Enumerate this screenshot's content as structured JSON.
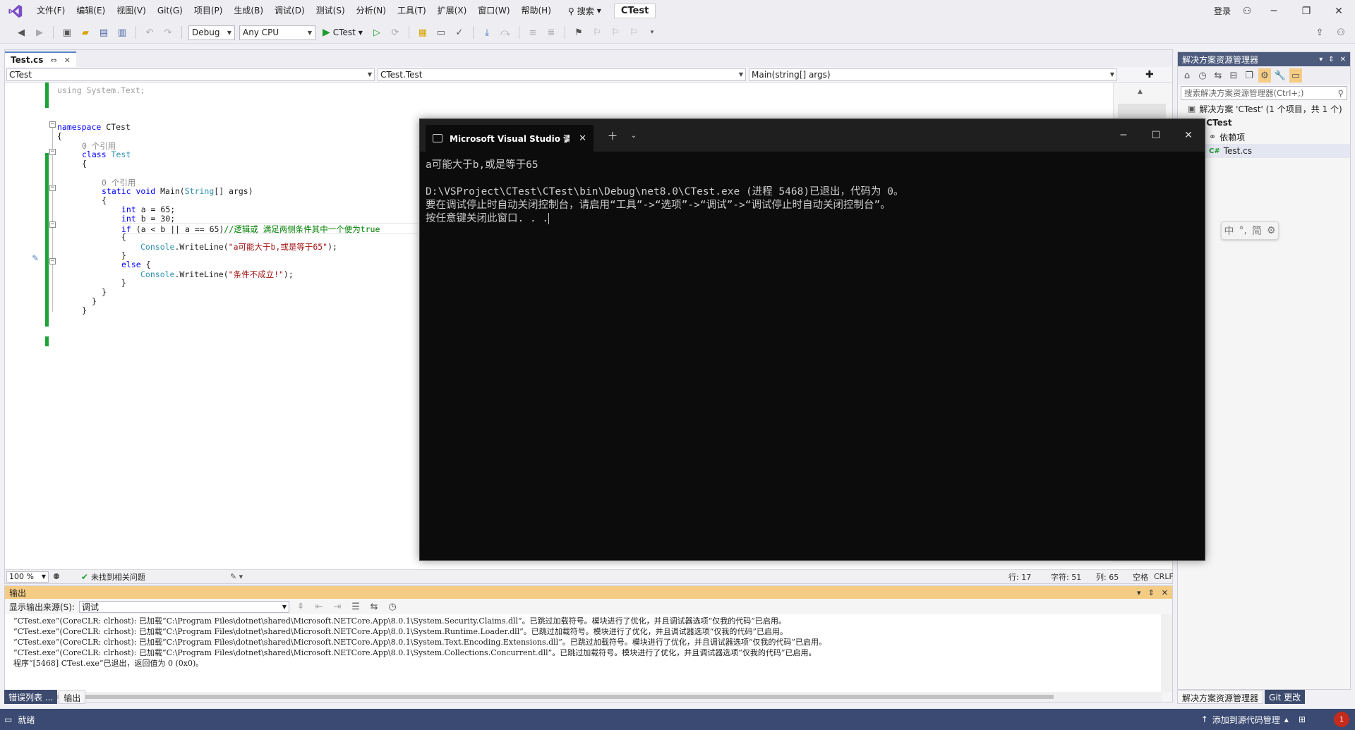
{
  "menubar": {
    "items": [
      "文件(F)",
      "编辑(E)",
      "视图(V)",
      "Git(G)",
      "项目(P)",
      "生成(B)",
      "调试(D)",
      "测试(S)",
      "分析(N)",
      "工具(T)",
      "扩展(X)",
      "窗口(W)",
      "帮助(H)"
    ],
    "search_label": "搜索",
    "solution_name": "CTest",
    "login_label": "登录"
  },
  "toolbar": {
    "config": "Debug",
    "platform": "Any CPU",
    "run_label": "CTest"
  },
  "editor": {
    "tab_label": "Test.cs",
    "nav": {
      "project": "CTest",
      "type": "CTest.Test",
      "member": "Main(string[] args)"
    },
    "lines": {
      "l1": "using System.Text;",
      "ns_kw": "namespace",
      "ns_name": " CTest",
      "brace_open": "{",
      "ref0": "0 个引用",
      "class_kw": "class",
      "class_name": " Test",
      "ref1": "0 个引用",
      "main_static": "static",
      "main_void": " void",
      "main_name": " Main(",
      "main_string": "String",
      "main_args": "[] args)",
      "int_a_kw": "int",
      "int_a": " a = 65;",
      "int_b_kw": "int",
      "int_b": " b = 30;",
      "if_kw": "if",
      "if_cond": " (a < b || a == 65)",
      "if_comment": "//逻辑或 满足两侧条件其中一个便为true",
      "console1_obj": "Console",
      "console1_method": ".WriteLine(",
      "console1_str": "\"a可能大于b,或是等于65\"",
      "console1_end": ");",
      "else_kw": "else",
      "else_brace": " {",
      "console2_obj": "Console",
      "console2_method": ".WriteLine(",
      "console2_str": "\"条件不成立!\"",
      "console2_end": ");",
      "brace_close": "}"
    },
    "status": {
      "zoom": "100 %",
      "issues": "未找到相关问题",
      "line": "行: 17",
      "char": "字符: 51",
      "col": "列: 65",
      "whitespace": "空格",
      "eol": "CRLF"
    }
  },
  "console": {
    "tab_title": "Microsoft Visual Studio 调试控制台",
    "lines": [
      "a可能大于b,或是等于65",
      "",
      "D:\\VSProject\\CTest\\CTest\\bin\\Debug\\net8.0\\CTest.exe (进程 5468)已退出，代码为 0。",
      "要在调试停止时自动关闭控制台，请启用“工具”->“选项”->“调试”->“调试停止时自动关闭控制台”。",
      "按任意键关闭此窗口. . ."
    ]
  },
  "output": {
    "title": "输出",
    "source_label": "显示输出来源(S):",
    "source_value": "调试",
    "lines": [
      "“CTest.exe”(CoreCLR: clrhost): 已加载“C:\\Program Files\\dotnet\\shared\\Microsoft.NETCore.App\\8.0.1\\System.Security.Claims.dll”。已跳过加载符号。模块进行了优化，并且调试器选项“仅我的代码”已启用。",
      "“CTest.exe”(CoreCLR: clrhost): 已加载“C:\\Program Files\\dotnet\\shared\\Microsoft.NETCore.App\\8.0.1\\System.Runtime.Loader.dll”。已跳过加载符号。模块进行了优化，并且调试器选项“仅我的代码”已启用。",
      "“CTest.exe”(CoreCLR: clrhost): 已加载“C:\\Program Files\\dotnet\\shared\\Microsoft.NETCore.App\\8.0.1\\System.Text.Encoding.Extensions.dll”。已跳过加载符号。模块进行了优化，并且调试器选项“仅我的代码”已启用。",
      "“CTest.exe”(CoreCLR: clrhost): 已加载“C:\\Program Files\\dotnet\\shared\\Microsoft.NETCore.App\\8.0.1\\System.Collections.Concurrent.dll”。已跳过加载符号。模块进行了优化，并且调试器选项“仅我的代码”已启用。",
      "程序“[5468] CTest.exe”已退出，返回值为 0 (0x0)。"
    ],
    "bottom_tabs": [
      "错误列表 ...",
      "输出"
    ]
  },
  "solution_explorer": {
    "title": "解决方案资源管理器",
    "search_placeholder": "搜索解决方案资源管理器(Ctrl+;)",
    "solution_row": "解决方案 'CTest' (1 个项目，共 1 个)",
    "project_row": "CTest",
    "deps_row": "依赖项",
    "file_row": "Test.cs",
    "bottom_tabs": [
      "解决方案资源管理器",
      "Git 更改"
    ]
  },
  "ime": {
    "lang": "中",
    "punct": "°,",
    "mode": "简"
  },
  "statusbar": {
    "ready": "就绪",
    "add_to_source": "添加到源代码管理",
    "notifications": "1"
  }
}
